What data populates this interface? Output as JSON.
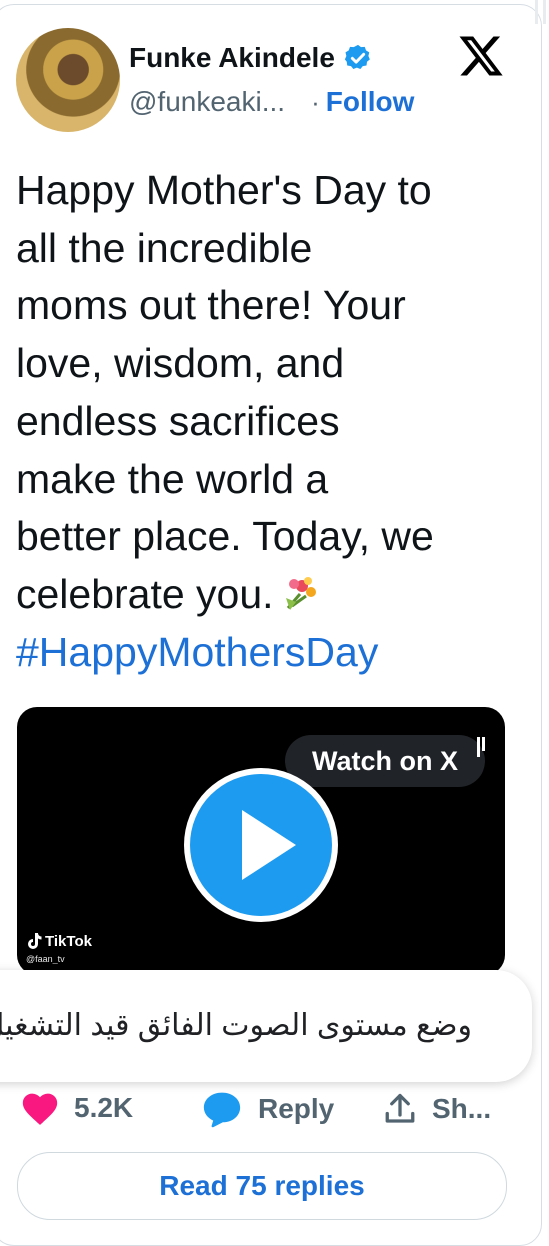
{
  "author": {
    "name": "Funke Akindele",
    "handle": "@funkeaki...",
    "separator": "·",
    "follow_label": "Follow"
  },
  "tweet": {
    "text": "Happy Mother's Day to\nall the incredible\nmoms out there! Your\nlove, wisdom, and\nendless sacrifices\nmake the world a\nbetter place. Today, we\ncelebrate you.",
    "emoji": "bouquet-icon",
    "hashtag": "#HappyMothersDay"
  },
  "video": {
    "watch_label": "Watch on X",
    "tiktok_brand": "TikTok",
    "tiktok_handle": "@faan_tv"
  },
  "toast": {
    "text": "وضع مستوى الصوت الفائق قيد التشغيل"
  },
  "actions": {
    "like_count": "5.2K",
    "reply_label": "Reply",
    "share_label": "Sh..."
  },
  "read_replies_label": "Read 75 replies",
  "colors": {
    "link_blue": "#1d70d6",
    "play_blue": "#1d9bf0",
    "like_pink": "#f91880",
    "text": "#0f1419",
    "muted": "#536471"
  }
}
